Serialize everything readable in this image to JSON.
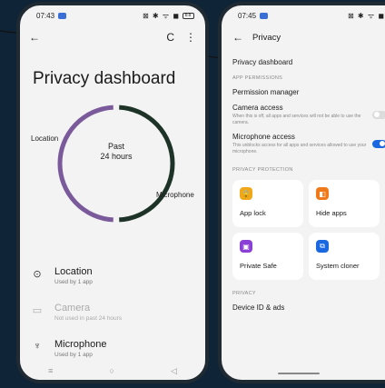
{
  "left": {
    "status": {
      "time": "07:43",
      "icons": "⊠ ✱ ᯤ ◼",
      "battery": "88"
    },
    "appbar": {
      "back": "←",
      "refresh": "C",
      "more": "⋮"
    },
    "title": "Privacy dashboard",
    "ring": {
      "center_top": "Past",
      "center_bottom": "24 hours",
      "label_location": "Location",
      "label_microphone": "Microphone",
      "location_share": 0.5,
      "microphone_share": 0.5,
      "location_color": "#7a5a9a",
      "microphone_color": "#1e3328"
    },
    "permissions": [
      {
        "icon": "⊙",
        "title": "Location",
        "sub": "Used by 1 app"
      },
      {
        "icon": "▭",
        "title": "Camera",
        "sub": "Not used in past 24 hours"
      },
      {
        "icon": "♆",
        "title": "Microphone",
        "sub": "Used by 1 app"
      }
    ],
    "nav": {
      "menu": "≡",
      "home": "○",
      "back": "◁"
    }
  },
  "right": {
    "status": {
      "time": "07:45",
      "icons": "⊠ ✱ ᯤ ◼"
    },
    "appbar": {
      "back": "←",
      "title": "Privacy"
    },
    "dashboard_item": "Privacy dashboard",
    "section_app_permissions": "APP PERMISSIONS",
    "permission_manager": "Permission manager",
    "camera_access": {
      "title": "Camera access",
      "desc": "When this is off, all apps and services will not be able to use the camera.",
      "on": false
    },
    "microphone_access": {
      "title": "Microphone access",
      "desc": "This unblocks access for all apps and services allowed to use your microphone.",
      "on": true
    },
    "section_privacy_protection": "PRIVACY PROTECTION",
    "tiles": [
      {
        "label": "App lock",
        "icon": "🔒",
        "color": "#f0a81a"
      },
      {
        "label": "Hide apps",
        "icon": "◧",
        "color": "#f07a1a"
      },
      {
        "label": "Private Safe",
        "icon": "▣",
        "color": "#8a3fd6"
      },
      {
        "label": "System cloner",
        "icon": "⧉",
        "color": "#1b67e0"
      }
    ],
    "section_privacy": "PRIVACY",
    "device_id": "Device ID & ads"
  }
}
